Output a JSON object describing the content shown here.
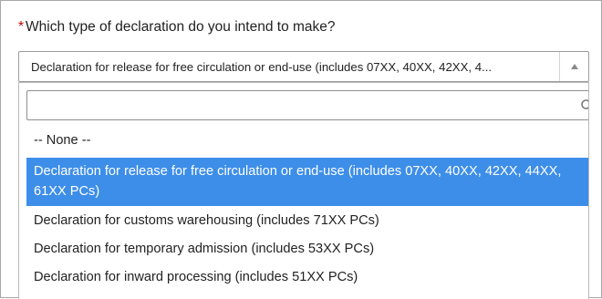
{
  "question": {
    "required_marker": "*",
    "label": "Which type of declaration do you intend to make?"
  },
  "select": {
    "value": "Declaration for release for free circulation or end-use (includes 07XX, 40XX, 42XX, 4...",
    "arrow_icon": "caret-up-icon"
  },
  "dropdown": {
    "search": {
      "value": "",
      "placeholder": "",
      "icon": "search-icon"
    },
    "options": [
      {
        "label": "-- None --",
        "selected": false
      },
      {
        "label": "Declaration for release for free circulation or end-use (includes 07XX, 40XX, 42XX, 44XX, 61XX PCs)",
        "selected": true
      },
      {
        "label": "Declaration for customs warehousing (includes 71XX PCs)",
        "selected": false
      },
      {
        "label": "Declaration for temporary admission (includes 53XX PCs)",
        "selected": false
      },
      {
        "label": "Declaration for inward processing (includes 51XX PCs)",
        "selected": false
      }
    ]
  },
  "colors": {
    "selected_bg": "#3d8ee8",
    "required": "#c00000"
  }
}
